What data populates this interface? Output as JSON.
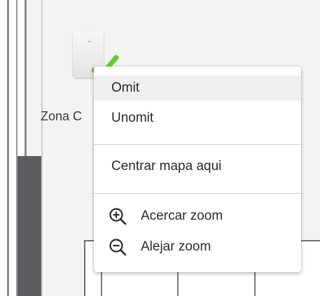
{
  "map": {
    "zone_label": "Zona C"
  },
  "colors": {
    "check_green": "#5bd02a",
    "menu_hover": "#efefef",
    "dark_block": "#5c5d61"
  },
  "context_menu": {
    "items": [
      {
        "label": "Omit",
        "icon": null
      },
      {
        "label": "Unomit",
        "icon": null
      },
      {
        "label": "Centrar mapa aqui",
        "icon": null
      },
      {
        "label": "Acercar zoom",
        "icon": "zoom-in-icon"
      },
      {
        "label": "Alejar zoom",
        "icon": "zoom-out-icon"
      }
    ]
  }
}
